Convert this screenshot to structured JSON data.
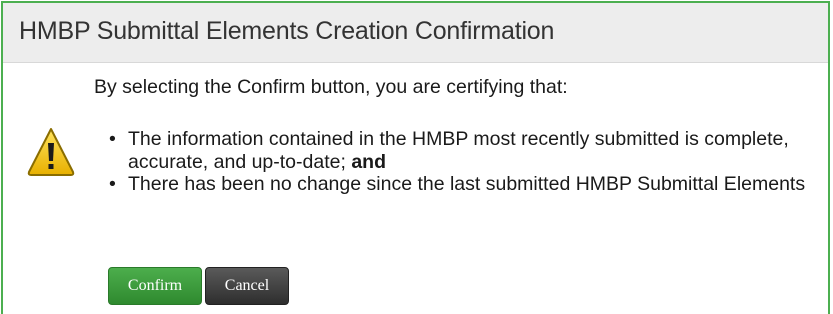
{
  "dialog": {
    "title": "HMBP Submittal Elements Creation Confirmation",
    "lead_text": "By selecting the Confirm button, you are certifying that:",
    "icon": "warning-icon",
    "bullets": [
      {
        "text": "The information contained in the HMBP most recently submitted is complete, accurate, and up-to-date; ",
        "bold_suffix": "and"
      },
      {
        "text": "There has been no change since the last submitted HMBP Submittal Elements",
        "bold_suffix": ""
      }
    ],
    "buttons": {
      "confirm_label": "Confirm",
      "cancel_label": "Cancel"
    },
    "colors": {
      "border": "#4caf50",
      "titlebar": "#ededed",
      "confirm": "#3c9c3c",
      "cancel": "#3a3a3a",
      "warning": "#f2c811"
    }
  }
}
